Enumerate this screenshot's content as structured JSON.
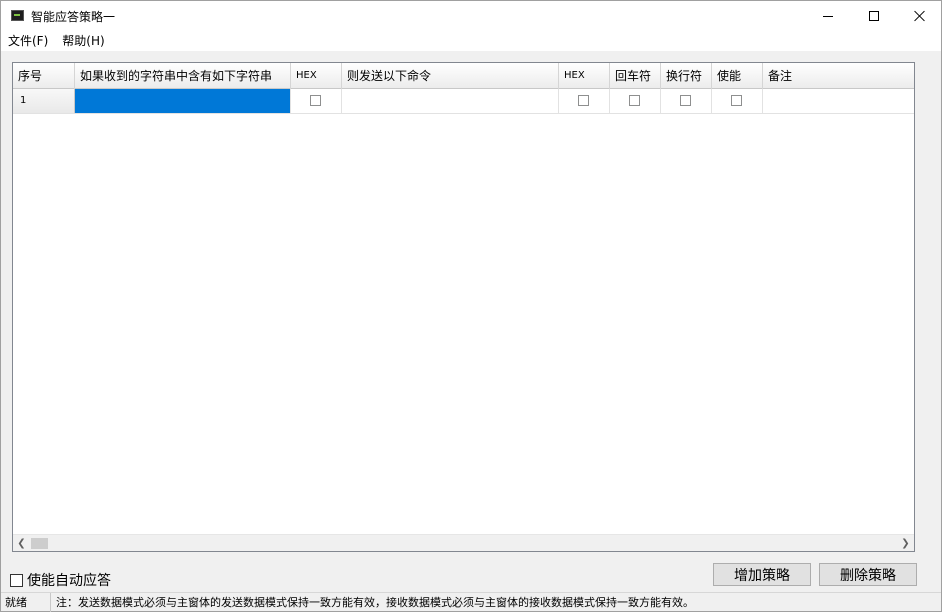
{
  "window": {
    "title": "智能应答策略一"
  },
  "menu": {
    "file": "文件(F)",
    "help": "帮助(H)"
  },
  "grid": {
    "columns": [
      {
        "label": "序号",
        "small": false
      },
      {
        "label": "如果收到的字符串中含有如下字符串",
        "small": false
      },
      {
        "label": "HEX",
        "small": true
      },
      {
        "label": "则发送以下命令",
        "small": false
      },
      {
        "label": "HEX",
        "small": true
      },
      {
        "label": "回车符",
        "small": false
      },
      {
        "label": "换行符",
        "small": false
      },
      {
        "label": "使能",
        "small": false
      },
      {
        "label": "备注",
        "small": false
      }
    ],
    "rows": [
      {
        "index": "1",
        "receive": "",
        "receive_hex": false,
        "send": "",
        "send_hex": false,
        "cr": false,
        "lf": false,
        "enabled": false,
        "note": ""
      }
    ]
  },
  "controls": {
    "auto_reply_label": "使能自动应答",
    "auto_reply_checked": false,
    "add_button": "增加策略",
    "delete_button": "删除策略"
  },
  "status": {
    "state": "就绪",
    "note": "注：发送数据模式必须与主窗体的发送数据模式保持一致方能有效，接收数据模式必须与主窗体的接收数据模式保持一致方能有效。"
  }
}
